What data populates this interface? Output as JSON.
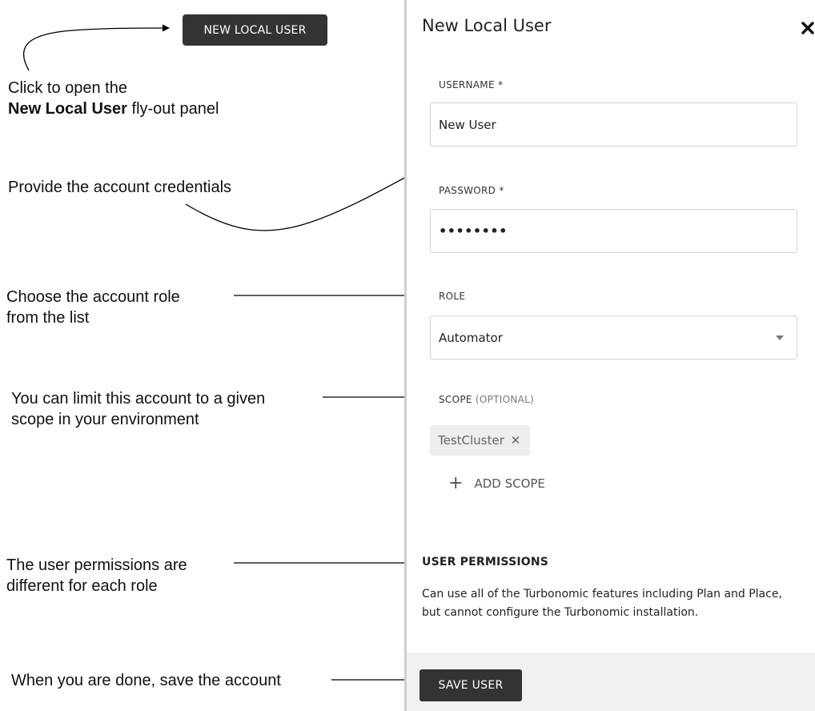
{
  "toolbar": {
    "new_user_button": "NEW LOCAL USER"
  },
  "annotations": {
    "open_panel_line1": "Click to open the",
    "open_panel_bold": "New Local User",
    "open_panel_rest": " fly-out panel",
    "credentials": "Provide the account credentials",
    "role_line1": "Choose the account role",
    "role_line2": "from the list",
    "scope_line1": "You can limit this account to a given",
    "scope_line2": "scope in your environment",
    "permissions_line1": "The user permissions are",
    "permissions_line2": "different for each role",
    "save": "When you are done, save the account"
  },
  "panel": {
    "title": "New Local User",
    "close_icon": "close-icon",
    "username": {
      "label": "USERNAME *",
      "value": "New User"
    },
    "password": {
      "label": "PASSWORD *",
      "value": "••••••••"
    },
    "role": {
      "label": "ROLE",
      "value": "Automator",
      "caret_icon": "chevron-down-icon"
    },
    "scope": {
      "label": "SCOPE",
      "label_suffix": "(OPTIONAL)",
      "chips": [
        {
          "label": "TestCluster",
          "remove_icon": "close-icon"
        }
      ],
      "add_label": "ADD SCOPE",
      "add_icon": "plus-icon"
    },
    "permissions": {
      "title": "USER PERMISSIONS",
      "description": "Can use all of the Turbonomic features including Plan and Place, but cannot configure the Turbonomic installation."
    },
    "save_button": "SAVE USER"
  },
  "colors": {
    "button_bg": "#333333",
    "panel_border": "#cfcfcf",
    "footer_bg": "#f1f1f1",
    "chip_bg": "#eeeeee"
  }
}
